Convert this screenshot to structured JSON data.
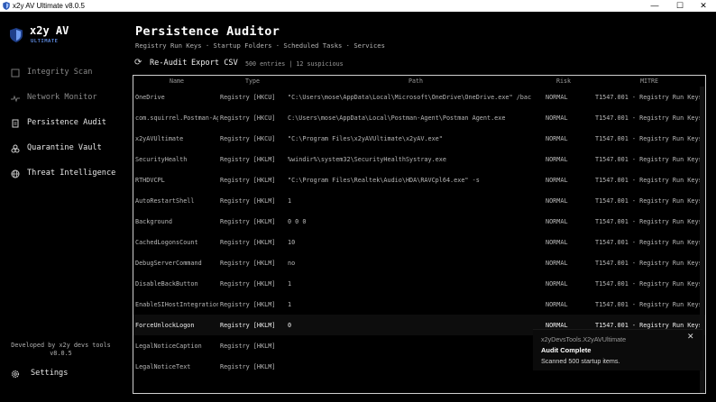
{
  "window": {
    "title": "x2y AV Ultimate v8.0.5",
    "minimize_glyph": "—",
    "maximize_glyph": "☐",
    "close_glyph": "✕"
  },
  "sidebar": {
    "brand_name": "x2y AV",
    "brand_sub": "ULTIMATE",
    "items": [
      {
        "label": "Integrity Scan",
        "icon": "scan-icon"
      },
      {
        "label": "Network Monitor",
        "icon": "pulse-icon"
      },
      {
        "label": "Persistence Audit",
        "icon": "document-icon"
      },
      {
        "label": "Quarantine Vault",
        "icon": "biohazard-icon"
      },
      {
        "label": "Threat Intelligence",
        "icon": "globe-icon"
      }
    ],
    "footer_line1": "Developed by x2y devs tools",
    "footer_line2": "v8.0.5",
    "settings_label": "Settings"
  },
  "main": {
    "title": "Persistence Auditor",
    "subtitle": "Registry Run Keys · Startup Folders · Scheduled Tasks · Services",
    "reaudit_label": "Re-Audit",
    "export_label": "Export CSV",
    "counts": "500 entries | 12 suspicious"
  },
  "table": {
    "headers": [
      "Name",
      "Type",
      "Path",
      "Risk",
      "MITRE"
    ],
    "rows": [
      {
        "name": "OneDrive",
        "type": "Registry [HKCU]",
        "path": "\"C:\\Users\\mose\\AppData\\Local\\Microsoft\\OneDrive\\OneDrive.exe\" /background",
        "risk": "NORMAL",
        "mitre": "T1547.001 - Registry Run Keys"
      },
      {
        "name": "com.squirrel.Postman-Agent",
        "type": "Registry [HKCU]",
        "path": "C:\\Users\\mose\\AppData\\Local\\Postman-Agent\\Postman Agent.exe",
        "risk": "NORMAL",
        "mitre": "T1547.001 - Registry Run Keys"
      },
      {
        "name": "x2yAVUltimate",
        "type": "Registry [HKCU]",
        "path": "\"C:\\Program Files\\x2yAVUltimate\\x2yAV.exe\"",
        "risk": "NORMAL",
        "mitre": "T1547.001 - Registry Run Keys"
      },
      {
        "name": "SecurityHealth",
        "type": "Registry [HKLM]",
        "path": "%windir%\\system32\\SecurityHealthSystray.exe",
        "risk": "NORMAL",
        "mitre": "T1547.001 - Registry Run Keys"
      },
      {
        "name": "RTHDVCPL",
        "type": "Registry [HKLM]",
        "path": "\"C:\\Program Files\\Realtek\\Audio\\HDA\\RAVCpl64.exe\" -s",
        "risk": "NORMAL",
        "mitre": "T1547.001 - Registry Run Keys"
      },
      {
        "name": "AutoRestartShell",
        "type": "Registry [HKLM]",
        "path": "1",
        "risk": "NORMAL",
        "mitre": "T1547.001 - Registry Run Keys"
      },
      {
        "name": "Background",
        "type": "Registry [HKLM]",
        "path": "0 0 0",
        "risk": "NORMAL",
        "mitre": "T1547.001 - Registry Run Keys"
      },
      {
        "name": "CachedLogonsCount",
        "type": "Registry [HKLM]",
        "path": "10",
        "risk": "NORMAL",
        "mitre": "T1547.001 - Registry Run Keys"
      },
      {
        "name": "DebugServerCommand",
        "type": "Registry [HKLM]",
        "path": "no",
        "risk": "NORMAL",
        "mitre": "T1547.001 - Registry Run Keys"
      },
      {
        "name": "DisableBackButton",
        "type": "Registry [HKLM]",
        "path": "1",
        "risk": "NORMAL",
        "mitre": "T1547.001 - Registry Run Keys"
      },
      {
        "name": "EnableSIHostIntegration",
        "type": "Registry [HKLM]",
        "path": "1",
        "risk": "NORMAL",
        "mitre": "T1547.001 - Registry Run Keys"
      },
      {
        "name": "ForceUnlockLogon",
        "type": "Registry [HKLM]",
        "path": "0",
        "risk": "NORMAL",
        "mitre": "T1547.001 - Registry Run Keys"
      },
      {
        "name": "LegalNoticeCaption",
        "type": "Registry [HKLM]",
        "path": "",
        "risk": "",
        "mitre": ""
      },
      {
        "name": "LegalNoticeText",
        "type": "Registry [HKLM]",
        "path": "",
        "risk": "",
        "mitre": ""
      }
    ]
  },
  "toast": {
    "app": "x2yDevsTools.X2yAVUltimate",
    "title": "Audit Complete",
    "message": "Scanned 500 startup items.",
    "close_glyph": "✕"
  },
  "colors": {
    "background": "#000000",
    "brand_accent": "#5b86d9",
    "border": "#cfcfcf"
  }
}
